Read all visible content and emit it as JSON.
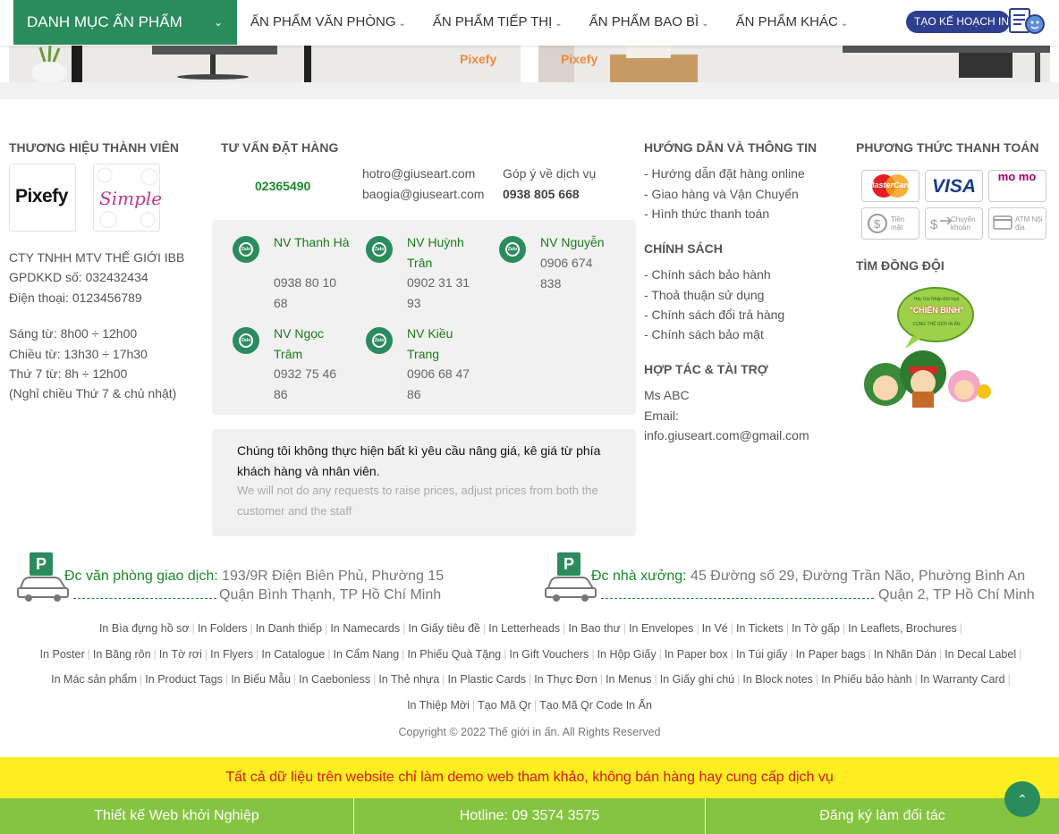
{
  "header": {
    "category_button": "DANH MỤC ẤN PHẨM",
    "nav": [
      {
        "label": "ẤN PHẨM VĂN PHÒNG"
      },
      {
        "label": "ẤN PHẨM TIẾP THỊ"
      },
      {
        "label": "ẤN PHẨM BAO BÌ"
      },
      {
        "label": "ẤN PHẨM KHÁC"
      }
    ],
    "plan_button": "TẠO KẾ HOẠCH IN"
  },
  "banners": {
    "watermark": "Pixefy"
  },
  "brands": {
    "title": "THƯƠNG HIỆU THÀNH VIÊN",
    "logo1": "Pixefy",
    "logo2": "Simple",
    "company": "CTY TNHH MTV THẾ GIỚI IBB",
    "license": "GPDKKD số: 032432434",
    "phone": "Điện thoại: 0123456789",
    "hours": [
      "Sáng từ: 8h00 ÷ 12h00",
      "Chiều từ: 13h30 ÷ 17h30",
      "Thứ 7 từ: 8h ÷ 12h00",
      "(Nghỉ chiều Thứ 7 & chủ nhật)"
    ]
  },
  "consult": {
    "title": "TƯ VẤN ĐẶT HÀNG",
    "hotline": "02365490",
    "email1": "hotro@giuseart.com",
    "email2": "baogia@giuseart.com",
    "feedback_label": "Góp ý về dịch vụ",
    "feedback_phone": "0938 805 668",
    "zalo_label": "Zalo",
    "staff": [
      {
        "name": "NV Thanh Hà",
        "phone": "0938 80 10 68"
      },
      {
        "name": "NV Huỳnh Trân",
        "phone": "0902 31 31 93"
      },
      {
        "name": "NV Nguyễn",
        "phone": "0906 674 838"
      },
      {
        "name": "NV Ngọc Trâm",
        "phone": "0932 75 46 86"
      },
      {
        "name": "NV Kiều Trang",
        "phone": "0906 68 47 86"
      }
    ],
    "notice_vi": "Chúng tôi không thực hiện bất kì yêu cầu nâng giá, kê giá từ phía khách hàng và nhân viên.",
    "notice_en": "We will not do any requests to raise prices, adjust prices from both the customer and the staff"
  },
  "guide": {
    "title": "HƯỚNG DẪN VÀ THÔNG TIN",
    "items": [
      "- Hướng dẫn đặt hàng online",
      "- Giao hàng và Vận Chuyển",
      "- Hình thức thanh toán"
    ],
    "policy_title": "CHÍNH SÁCH",
    "policies": [
      "- Chính sách bảo hành",
      "- Thoả thuận sử dụng",
      "- Chính sách đổi trả hàng",
      "- Chính sách bảo mật"
    ],
    "partner_title": "HỢP TÁC & TÀI TRỢ",
    "partner_name": "Ms ABC",
    "partner_email_label": "Email:",
    "partner_email": "info.giuseart.com@gmail.com"
  },
  "payment": {
    "title": "PHƯƠNG THỨC THANH TOÁN",
    "methods": [
      {
        "label": "MasterCard",
        "color": "#e31e24"
      },
      {
        "label": "VISA",
        "color": "#1a3c8f"
      },
      {
        "label": "mo mo",
        "color": "#a50064"
      },
      {
        "label": "Tiền mặt",
        "color": "#888888"
      },
      {
        "label": "Chuyển khoản",
        "color": "#888888"
      },
      {
        "label": "ATM Nội địa",
        "color": "#888888"
      }
    ],
    "team_title": "TÌM ĐỒNG ĐỘI",
    "team_bubble_top": "Hãy Gia Nhập Đội Ngũ",
    "team_bubble_main": "\"CHIẾN BINH\"",
    "team_bubble_bottom": "CÙNG THẾ GIỚI IN ẤN"
  },
  "addresses": [
    {
      "label": "Đc văn phòng giao dịch:",
      "line1": "193/9R Điện Biên Phủ, Phường 15",
      "line2": "Quận Bình Thạnh, TP Hồ Chí Minh"
    },
    {
      "label": "Đc nhà xưởng:",
      "line1": "45 Đường số 29, Đường Trần Não, Phường Bình An",
      "line2": "Quận 2, TP Hồ Chí Minh"
    }
  ],
  "parking_letter": "P",
  "tag_rows": [
    [
      "In Bìa đựng hồ sơ",
      "In Folders",
      "In Danh thiếp",
      "In Namecards",
      "In Giấy tiêu đề",
      "In Letterheads",
      "In Bao thư",
      "In Envelopes",
      "In Vé",
      "In Tickets",
      "In Tờ gấp",
      "In Leaflets, Brochures"
    ],
    [
      "In Poster",
      "In Băng rôn",
      "In Tờ rơi",
      "In Flyers",
      "In Catalogue",
      "In Cẩm Nang",
      "In Phiếu Quà Tặng",
      "In Gift Vouchers",
      "In Hộp Giấy",
      "In Paper box",
      "In Túi giấy",
      "In Paper bags",
      "In Nhãn Dán",
      "In Decal Label"
    ],
    [
      "In Mác sản phẩm",
      "In Product Tags",
      "In Biểu Mẫu",
      "In Caebonless",
      "In Thẻ nhựa",
      "In Plastic Cards",
      "In Thực Đơn",
      "In Menus",
      "In Giấy ghi chú",
      "In Block notes",
      "In Phiếu bảo hành",
      "In Warranty Card"
    ],
    [
      "In Thiệp Mời",
      "Tạo Mã Qr",
      "Tạo Mã Qr Code In Ấn"
    ]
  ],
  "copyright": "Copyright © 2022 Thế giới in ấn. All Rights Reserved",
  "demo_notice": "Tất cả dữ liệu trên website chỉ làm demo web tham khảo, không bán hàng hay cung cấp dịch vụ",
  "bottom_bar": {
    "design": "Thiết kế Web khởi Nghiệp",
    "hotline": "Hotline: 09 3574 3575",
    "partner": "Đăng ký làm đối tác"
  },
  "colors": {
    "primary": "#2a8c5c",
    "accent_green": "#85c440",
    "demo_bg": "#fdee21",
    "demo_text": "#e0141e",
    "plan_btn": "#2e3f8f"
  }
}
